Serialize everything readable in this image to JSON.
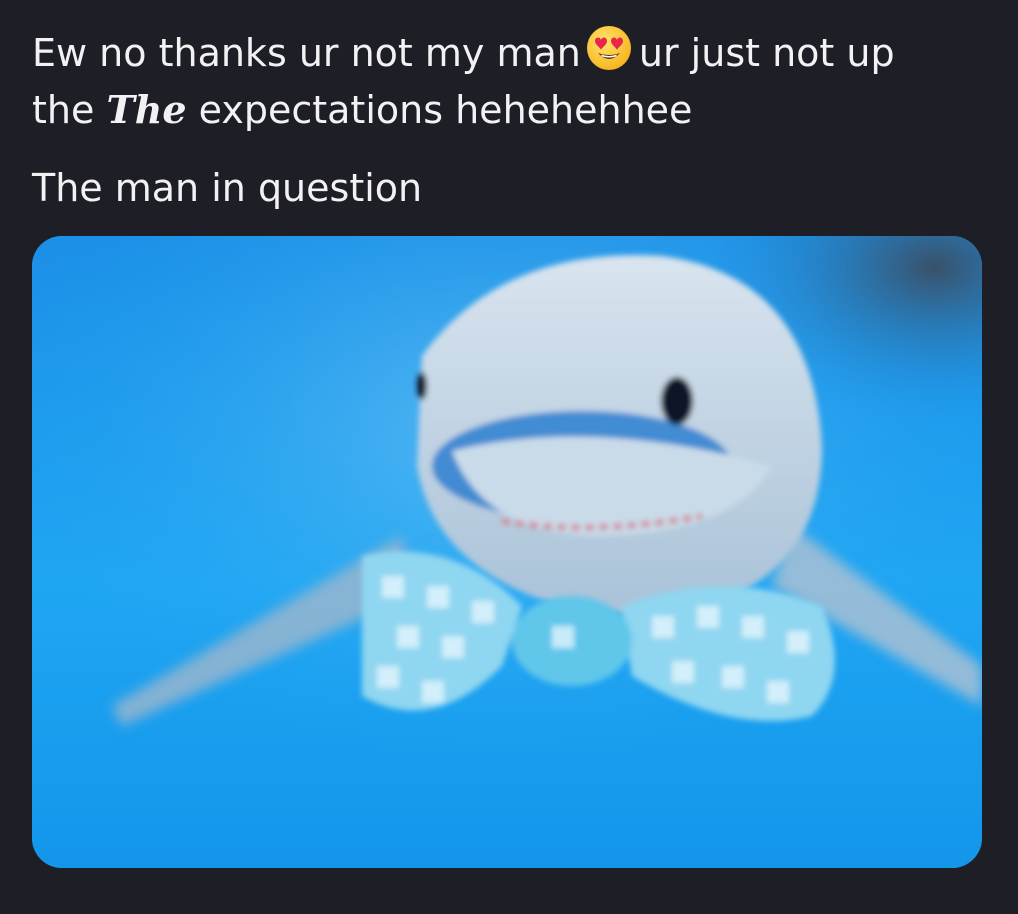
{
  "post": {
    "line1_part1": "Ew no thanks ur not my man",
    "emoji": "heart-eyes-emoji",
    "line1_part2": "ur just not up",
    "line2_before": "the",
    "line2_styled": "The",
    "line2_after": "expectations hehehehhee",
    "caption": "The man in question"
  },
  "colors": {
    "background": "#1e1f26",
    "text": "#f2f2f4",
    "image_blue": "#1a9cf0"
  },
  "media": {
    "subject": "shark-plush-with-bow-tie-image"
  }
}
